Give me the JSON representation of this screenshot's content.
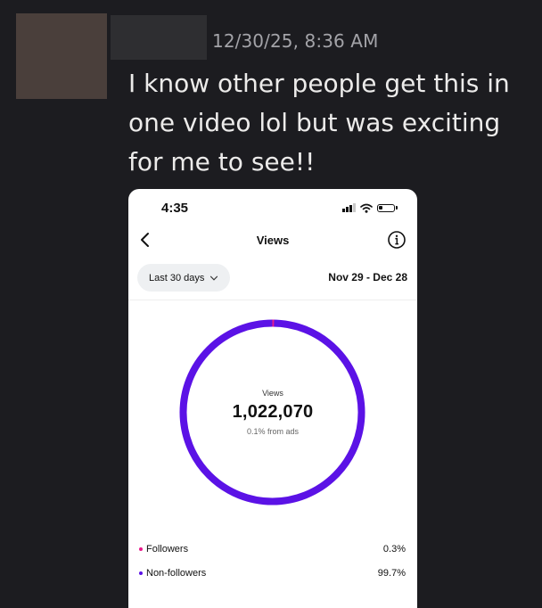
{
  "message": {
    "timestamp": "12/30/25, 8:36 AM",
    "text": "I know other people get this in one video lol but was exciting for me to see!!"
  },
  "phone": {
    "status_time": "4:35",
    "header_title": "Views",
    "period_label": "Last 30 days",
    "date_range": "Nov 29 - Dec 28",
    "donut": {
      "label": "Views",
      "value": "1,022,070",
      "sub": "0.1% from ads",
      "ring_color": "#5b12e6",
      "follower_fraction": 0.003
    },
    "legend": [
      {
        "label": "Followers",
        "value": "0.3%",
        "color": "#e8198b"
      },
      {
        "label": "Non-followers",
        "value": "99.7%",
        "color": "#5b12e6"
      }
    ]
  },
  "colors": {
    "background": "#1c1c20",
    "message_text": "#ecebea",
    "timestamp_text": "#a3a3a8"
  }
}
